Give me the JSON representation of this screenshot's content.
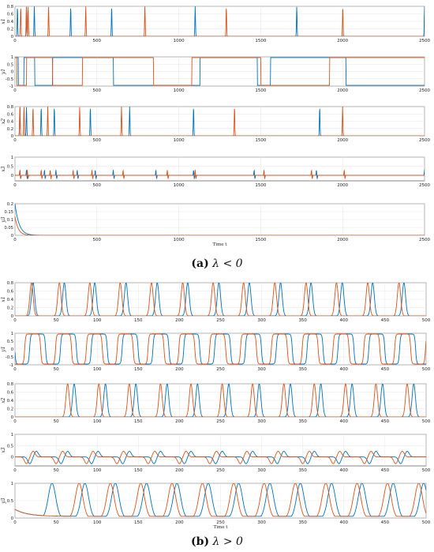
{
  "figure": {
    "caption_a_label": "(a)",
    "caption_a_math": "λ < 0",
    "caption_b_label": "(b)",
    "caption_b_math": "λ > 0",
    "xlabel": "Time t"
  },
  "colors": {
    "series_1": "#0072BD",
    "series_2": "#D95319",
    "grid": "#e6e6e6",
    "axis": "#333333"
  },
  "chart_data": [
    {
      "panel": "a",
      "type": "line",
      "plots": [
        {
          "ylabel": "x1",
          "xlim": [
            0,
            2500
          ],
          "ylim": [
            0,
            0.8
          ],
          "xticks": [
            "0",
            "500",
            "1000",
            "1500",
            "2000",
            "2500"
          ],
          "yticks": [
            "0",
            "0.2",
            "0.4",
            "0.6",
            "0.8"
          ],
          "kind": "spikes",
          "amp": 0.8,
          "series": [
            {
              "x": [
                15,
                70,
                118,
                340,
                590,
                1100,
                1720,
                2500
              ]
            },
            {
              "x": [
                35,
                70,
                80,
                205,
                432,
                793,
                1290,
                2001
              ]
            }
          ]
        },
        {
          "ylabel": "y1",
          "xlim": [
            0,
            2500
          ],
          "ylim": [
            -1,
            1
          ],
          "xticks": [
            "0",
            "500",
            "1000",
            "1500",
            "2000",
            "2500"
          ],
          "yticks": [
            "-1",
            "-0.5",
            "0",
            "0.5",
            "1"
          ],
          "kind": "square",
          "series": [
            {
              "high": [
                [
                  0,
                  20
                ],
                [
                  55,
                  120
                ],
                [
                  230,
                  600
                ],
                [
                  1130,
                  1480
                ],
                [
                  1560,
                  2020
                ]
              ]
            },
            {
              "high": [
                [
                  0,
                  12
                ],
                [
                  70,
                  230
                ],
                [
                  412,
                  845
                ],
                [
                  1080,
                  1500
                ],
                [
                  1920,
                  2500
                ]
              ]
            }
          ]
        },
        {
          "ylabel": "x2",
          "xlim": [
            0,
            2500
          ],
          "ylim": [
            0,
            0.8
          ],
          "xticks": [
            "0",
            "500",
            "1000",
            "1500",
            "2000",
            "2500"
          ],
          "yticks": [
            "0",
            "0.2",
            "0.4",
            "0.6",
            "0.8"
          ],
          "kind": "spikes",
          "amp": 0.8,
          "series": [
            {
              "x": [
                30,
                70,
                160,
                240,
                460,
                700,
                1090,
                1860
              ]
            },
            {
              "x": [
                30,
                55,
                110,
                200,
                395,
                650,
                1340,
                2000
              ]
            }
          ]
        },
        {
          "ylabel": "x3",
          "xlim": [
            0,
            2500
          ],
          "ylim": [
            -0.3,
            1
          ],
          "xticks": [
            "0",
            "500",
            "1000",
            "1500",
            "2000",
            "2500"
          ],
          "yticks": [
            "0",
            "0.5",
            "1"
          ],
          "kind": "bipolar",
          "amp": 0.3,
          "neg": -0.2,
          "series": [
            {
              "x": [
                30,
                70,
                180,
                250,
                380,
                490,
                600,
                860,
                1090,
                1460,
                1840,
                2500
              ]
            },
            {
              "x": [
                30,
                75,
                160,
                215,
                355,
                470,
                660,
                930,
                1100,
                1520,
                1810,
                2010
              ]
            }
          ]
        },
        {
          "ylabel": "y3",
          "xlim": [
            0,
            2500
          ],
          "ylim": [
            0,
            0.2
          ],
          "xticks": [
            "0",
            "500",
            "1000",
            "1500",
            "2000",
            "2500"
          ],
          "yticks": [
            "0",
            "0.05",
            "0.1",
            "0.15",
            "0.2"
          ],
          "kind": "decay",
          "start": 0.2,
          "end": 0.0,
          "tau": 25,
          "series": [
            {
              "x": []
            },
            {
              "x": []
            }
          ],
          "xlabel": "Time t"
        }
      ]
    },
    {
      "panel": "b",
      "type": "line",
      "plots": [
        {
          "ylabel": "x1",
          "xlim": [
            0,
            500
          ],
          "ylim": [
            0,
            0.8
          ],
          "xticks": [
            "0",
            "50",
            "100",
            "150",
            "200",
            "250",
            "300",
            "350",
            "400",
            "450",
            "500"
          ],
          "yticks": [
            "0",
            "0.2",
            "0.4",
            "0.6",
            "0.8"
          ],
          "kind": "pulses",
          "amp": 0.8,
          "width": 4,
          "series": [
            {
              "x": [
                22,
                60,
                97,
                135,
                173,
                210,
                248,
                285,
                323,
                360,
                398,
                435,
                473
              ]
            },
            {
              "x": [
                20,
                54,
                91,
                128,
                166,
                204,
                241,
                278,
                316,
                354,
                391,
                429,
                467
              ]
            }
          ]
        },
        {
          "ylabel": "y1",
          "xlim": [
            0,
            500
          ],
          "ylim": [
            -1,
            1
          ],
          "xticks": [
            "0",
            "50",
            "100",
            "150",
            "200",
            "250",
            "300",
            "350",
            "400",
            "450",
            "500"
          ],
          "yticks": [
            "-1",
            "-0.5",
            "0",
            "0.5",
            "1"
          ],
          "kind": "periodic_square",
          "period": 37.5,
          "series": [
            {
              "phase": 14
            },
            {
              "phase": 8
            }
          ]
        },
        {
          "ylabel": "x2",
          "xlim": [
            0,
            500
          ],
          "ylim": [
            0,
            0.8
          ],
          "xticks": [
            "0",
            "50",
            "100",
            "150",
            "200",
            "250",
            "300",
            "350",
            "400",
            "450",
            "500"
          ],
          "yticks": [
            "0",
            "0.2",
            "0.4",
            "0.6",
            "0.8"
          ],
          "kind": "pulses",
          "amp": 0.8,
          "width": 4,
          "series": [
            {
              "x": [
                72,
                110,
                147,
                185,
                222,
                260,
                297,
                335,
                372,
                410,
                447,
                485
              ]
            },
            {
              "x": [
                64,
                102,
                139,
                177,
                214,
                252,
                289,
                327,
                364,
                402,
                439,
                477
              ]
            }
          ]
        },
        {
          "ylabel": "x3",
          "xlim": [
            0,
            500
          ],
          "ylim": [
            -0.4,
            1
          ],
          "xticks": [
            "0",
            "50",
            "100",
            "150",
            "200",
            "250",
            "300",
            "350",
            "400",
            "450",
            "500"
          ],
          "yticks": [
            "0",
            "0.5",
            "1"
          ],
          "kind": "wiggle",
          "amp": 0.25,
          "neg": -0.3,
          "series": [
            {
              "x": [
                22,
                60,
                97,
                135,
                173,
                210,
                248,
                285,
                323,
                360,
                398,
                435,
                473
              ]
            },
            {
              "x": [
                18,
                54,
                91,
                128,
                166,
                204,
                241,
                278,
                316,
                354,
                391,
                429,
                467
              ]
            }
          ]
        },
        {
          "ylabel": "y3",
          "xlim": [
            0,
            500
          ],
          "ylim": [
            0,
            1
          ],
          "xticks": [
            "0",
            "50",
            "100",
            "150",
            "200",
            "250",
            "300",
            "350",
            "400",
            "450",
            "500"
          ],
          "yticks": [
            "0",
            "0.5",
            "1"
          ],
          "kind": "wave",
          "amp": 1.0,
          "width": 9,
          "series": [
            {
              "x": [
                45,
                85,
                122,
                160,
                197,
                235,
                272,
                310,
                347,
                385,
                422,
                460,
                497
              ]
            },
            {
              "x": [
                78,
                116,
                153,
                191,
                228,
                266,
                303,
                341,
                378,
                416,
                453,
                491
              ]
            }
          ],
          "xlabel": "Time t"
        }
      ]
    }
  ]
}
